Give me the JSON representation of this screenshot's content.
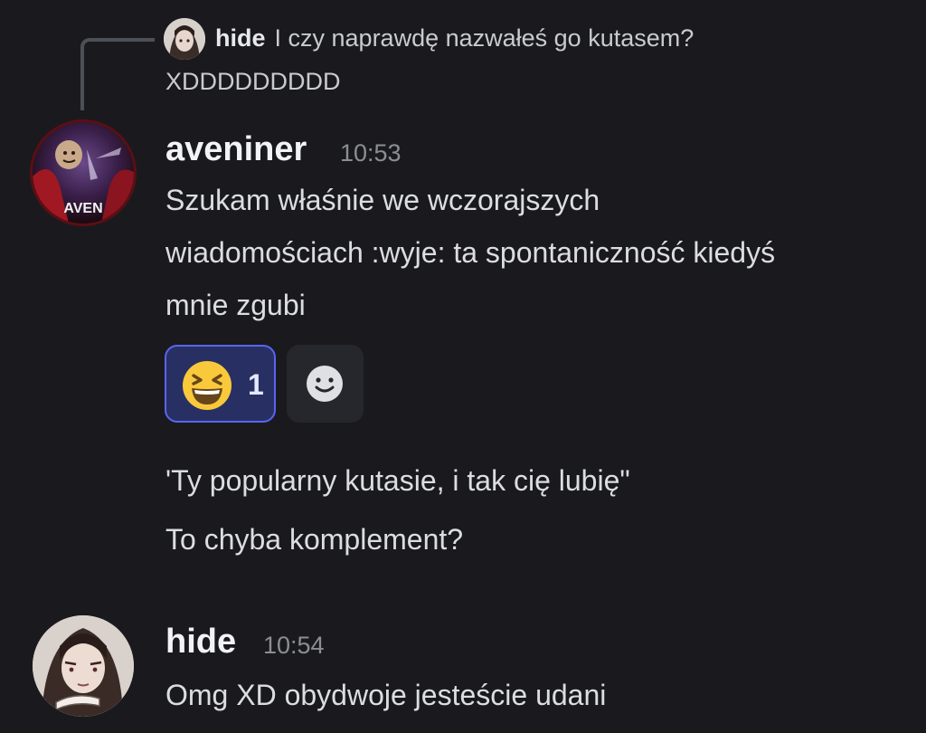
{
  "reply": {
    "author": "hide",
    "text": "I czy naprawdę nazwałeś go kutasem?",
    "continuation": "XDDDDDDDDD"
  },
  "messages": [
    {
      "author": "aveniner",
      "time": "10:53",
      "avatar_text": "AVEN",
      "lines": [
        "Szukam właśnie we wczorajszych",
        "wiadomościach :wyje: ta spontaniczność kiedyś",
        "mnie zgubi"
      ],
      "reactions": [
        {
          "emoji": "laughing-face",
          "count": "1",
          "selected": true
        }
      ],
      "followups": [
        "'Ty popularny kutasie, i tak cię lubię\"",
        "To chyba komplement?"
      ]
    },
    {
      "author": "hide",
      "time": "10:54",
      "lines": [
        "Omg XD obydwoje jesteście udani"
      ]
    }
  ],
  "colors": {
    "background": "#1a1a1e",
    "reaction_border": "#5865f2",
    "reaction_fill": "#283063",
    "timestamp": "#8b8e95"
  }
}
